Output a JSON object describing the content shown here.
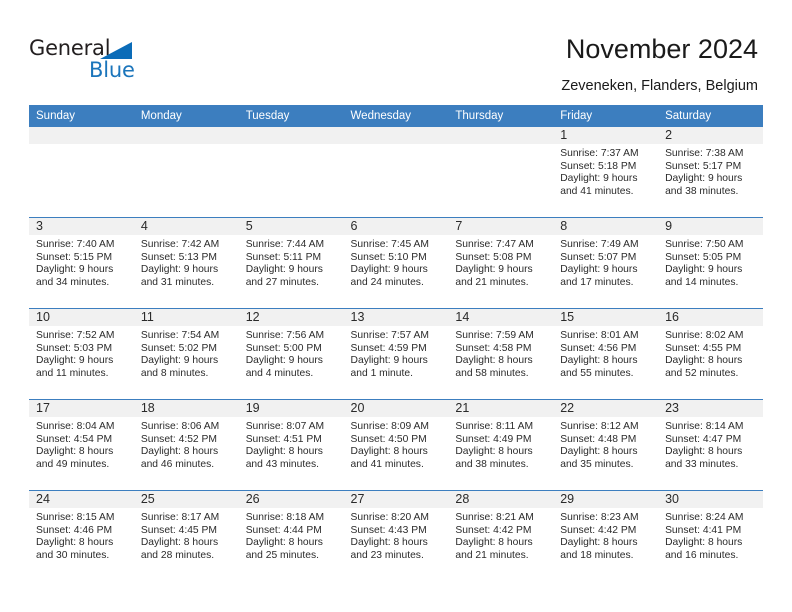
{
  "logo": {
    "word1": "General",
    "word2": "Blue",
    "triangle_color": "#0b6cb8",
    "blue_color": "#1b75bb"
  },
  "header": {
    "title": "November 2024",
    "subtitle": "Zeveneken, Flanders, Belgium"
  },
  "theme": {
    "header_blue": "#3c7ebf",
    "daynum_band": "#f1f1f1",
    "text": "#2b2b2b"
  },
  "weekday_headers": [
    "Sunday",
    "Monday",
    "Tuesday",
    "Wednesday",
    "Thursday",
    "Friday",
    "Saturday"
  ],
  "weeks": [
    [
      {
        "day": "",
        "empty": true,
        "sunrise": "",
        "sunset": "",
        "daylight1": "",
        "daylight2": ""
      },
      {
        "day": "",
        "empty": true,
        "sunrise": "",
        "sunset": "",
        "daylight1": "",
        "daylight2": ""
      },
      {
        "day": "",
        "empty": true,
        "sunrise": "",
        "sunset": "",
        "daylight1": "",
        "daylight2": ""
      },
      {
        "day": "",
        "empty": true,
        "sunrise": "",
        "sunset": "",
        "daylight1": "",
        "daylight2": ""
      },
      {
        "day": "",
        "empty": true,
        "sunrise": "",
        "sunset": "",
        "daylight1": "",
        "daylight2": ""
      },
      {
        "day": "1",
        "empty": false,
        "sunrise": "Sunrise: 7:37 AM",
        "sunset": "Sunset: 5:18 PM",
        "daylight1": "Daylight: 9 hours",
        "daylight2": "and 41 minutes."
      },
      {
        "day": "2",
        "empty": false,
        "sunrise": "Sunrise: 7:38 AM",
        "sunset": "Sunset: 5:17 PM",
        "daylight1": "Daylight: 9 hours",
        "daylight2": "and 38 minutes."
      }
    ],
    [
      {
        "day": "3",
        "empty": false,
        "sunrise": "Sunrise: 7:40 AM",
        "sunset": "Sunset: 5:15 PM",
        "daylight1": "Daylight: 9 hours",
        "daylight2": "and 34 minutes."
      },
      {
        "day": "4",
        "empty": false,
        "sunrise": "Sunrise: 7:42 AM",
        "sunset": "Sunset: 5:13 PM",
        "daylight1": "Daylight: 9 hours",
        "daylight2": "and 31 minutes."
      },
      {
        "day": "5",
        "empty": false,
        "sunrise": "Sunrise: 7:44 AM",
        "sunset": "Sunset: 5:11 PM",
        "daylight1": "Daylight: 9 hours",
        "daylight2": "and 27 minutes."
      },
      {
        "day": "6",
        "empty": false,
        "sunrise": "Sunrise: 7:45 AM",
        "sunset": "Sunset: 5:10 PM",
        "daylight1": "Daylight: 9 hours",
        "daylight2": "and 24 minutes."
      },
      {
        "day": "7",
        "empty": false,
        "sunrise": "Sunrise: 7:47 AM",
        "sunset": "Sunset: 5:08 PM",
        "daylight1": "Daylight: 9 hours",
        "daylight2": "and 21 minutes."
      },
      {
        "day": "8",
        "empty": false,
        "sunrise": "Sunrise: 7:49 AM",
        "sunset": "Sunset: 5:07 PM",
        "daylight1": "Daylight: 9 hours",
        "daylight2": "and 17 minutes."
      },
      {
        "day": "9",
        "empty": false,
        "sunrise": "Sunrise: 7:50 AM",
        "sunset": "Sunset: 5:05 PM",
        "daylight1": "Daylight: 9 hours",
        "daylight2": "and 14 minutes."
      }
    ],
    [
      {
        "day": "10",
        "empty": false,
        "sunrise": "Sunrise: 7:52 AM",
        "sunset": "Sunset: 5:03 PM",
        "daylight1": "Daylight: 9 hours",
        "daylight2": "and 11 minutes."
      },
      {
        "day": "11",
        "empty": false,
        "sunrise": "Sunrise: 7:54 AM",
        "sunset": "Sunset: 5:02 PM",
        "daylight1": "Daylight: 9 hours",
        "daylight2": "and 8 minutes."
      },
      {
        "day": "12",
        "empty": false,
        "sunrise": "Sunrise: 7:56 AM",
        "sunset": "Sunset: 5:00 PM",
        "daylight1": "Daylight: 9 hours",
        "daylight2": "and 4 minutes."
      },
      {
        "day": "13",
        "empty": false,
        "sunrise": "Sunrise: 7:57 AM",
        "sunset": "Sunset: 4:59 PM",
        "daylight1": "Daylight: 9 hours",
        "daylight2": "and 1 minute."
      },
      {
        "day": "14",
        "empty": false,
        "sunrise": "Sunrise: 7:59 AM",
        "sunset": "Sunset: 4:58 PM",
        "daylight1": "Daylight: 8 hours",
        "daylight2": "and 58 minutes."
      },
      {
        "day": "15",
        "empty": false,
        "sunrise": "Sunrise: 8:01 AM",
        "sunset": "Sunset: 4:56 PM",
        "daylight1": "Daylight: 8 hours",
        "daylight2": "and 55 minutes."
      },
      {
        "day": "16",
        "empty": false,
        "sunrise": "Sunrise: 8:02 AM",
        "sunset": "Sunset: 4:55 PM",
        "daylight1": "Daylight: 8 hours",
        "daylight2": "and 52 minutes."
      }
    ],
    [
      {
        "day": "17",
        "empty": false,
        "sunrise": "Sunrise: 8:04 AM",
        "sunset": "Sunset: 4:54 PM",
        "daylight1": "Daylight: 8 hours",
        "daylight2": "and 49 minutes."
      },
      {
        "day": "18",
        "empty": false,
        "sunrise": "Sunrise: 8:06 AM",
        "sunset": "Sunset: 4:52 PM",
        "daylight1": "Daylight: 8 hours",
        "daylight2": "and 46 minutes."
      },
      {
        "day": "19",
        "empty": false,
        "sunrise": "Sunrise: 8:07 AM",
        "sunset": "Sunset: 4:51 PM",
        "daylight1": "Daylight: 8 hours",
        "daylight2": "and 43 minutes."
      },
      {
        "day": "20",
        "empty": false,
        "sunrise": "Sunrise: 8:09 AM",
        "sunset": "Sunset: 4:50 PM",
        "daylight1": "Daylight: 8 hours",
        "daylight2": "and 41 minutes."
      },
      {
        "day": "21",
        "empty": false,
        "sunrise": "Sunrise: 8:11 AM",
        "sunset": "Sunset: 4:49 PM",
        "daylight1": "Daylight: 8 hours",
        "daylight2": "and 38 minutes."
      },
      {
        "day": "22",
        "empty": false,
        "sunrise": "Sunrise: 8:12 AM",
        "sunset": "Sunset: 4:48 PM",
        "daylight1": "Daylight: 8 hours",
        "daylight2": "and 35 minutes."
      },
      {
        "day": "23",
        "empty": false,
        "sunrise": "Sunrise: 8:14 AM",
        "sunset": "Sunset: 4:47 PM",
        "daylight1": "Daylight: 8 hours",
        "daylight2": "and 33 minutes."
      }
    ],
    [
      {
        "day": "24",
        "empty": false,
        "sunrise": "Sunrise: 8:15 AM",
        "sunset": "Sunset: 4:46 PM",
        "daylight1": "Daylight: 8 hours",
        "daylight2": "and 30 minutes."
      },
      {
        "day": "25",
        "empty": false,
        "sunrise": "Sunrise: 8:17 AM",
        "sunset": "Sunset: 4:45 PM",
        "daylight1": "Daylight: 8 hours",
        "daylight2": "and 28 minutes."
      },
      {
        "day": "26",
        "empty": false,
        "sunrise": "Sunrise: 8:18 AM",
        "sunset": "Sunset: 4:44 PM",
        "daylight1": "Daylight: 8 hours",
        "daylight2": "and 25 minutes."
      },
      {
        "day": "27",
        "empty": false,
        "sunrise": "Sunrise: 8:20 AM",
        "sunset": "Sunset: 4:43 PM",
        "daylight1": "Daylight: 8 hours",
        "daylight2": "and 23 minutes."
      },
      {
        "day": "28",
        "empty": false,
        "sunrise": "Sunrise: 8:21 AM",
        "sunset": "Sunset: 4:42 PM",
        "daylight1": "Daylight: 8 hours",
        "daylight2": "and 21 minutes."
      },
      {
        "day": "29",
        "empty": false,
        "sunrise": "Sunrise: 8:23 AM",
        "sunset": "Sunset: 4:42 PM",
        "daylight1": "Daylight: 8 hours",
        "daylight2": "and 18 minutes."
      },
      {
        "day": "30",
        "empty": false,
        "sunrise": "Sunrise: 8:24 AM",
        "sunset": "Sunset: 4:41 PM",
        "daylight1": "Daylight: 8 hours",
        "daylight2": "and 16 minutes."
      }
    ]
  ]
}
